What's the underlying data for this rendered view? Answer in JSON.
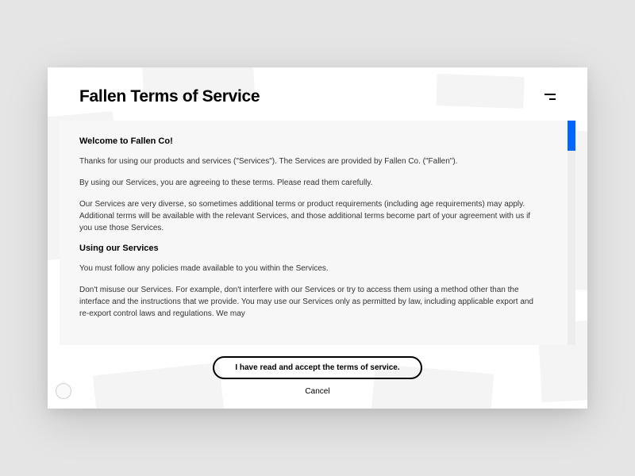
{
  "header": {
    "title": "Fallen Terms of Service"
  },
  "content": {
    "welcome_heading": "Welcome to Fallen Co!",
    "para1": "Thanks for using our products and services (\"Services\"). The Services are provided by Fallen Co. (\"Fallen\").",
    "para2": "By using our Services, you are agreeing to these terms. Please read them carefully.",
    "para3": "Our Services are very diverse, so sometimes additional terms or product requirements (including age requirements) may apply. Additional terms will be available with the relevant Services, and those additional terms become part of your agreement with us if you use those Services.",
    "using_heading": "Using our Services",
    "para4": "You must follow any policies made available to you within the Services.",
    "para5": "Don't misuse our Services. For example, don't interfere with our Services or try to access them using a method other than the interface and the instructions that we provide. You may use our Services only as permitted by law, including applicable export and re-export control laws and regulations. We may"
  },
  "footer": {
    "accept_label": "I have read and accept the terms of service.",
    "cancel_label": "Cancel"
  },
  "colors": {
    "accent": "#0066ff"
  }
}
